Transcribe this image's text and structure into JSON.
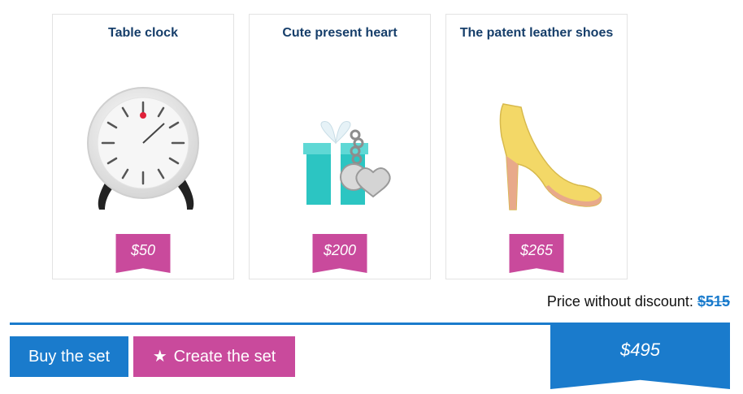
{
  "products": [
    {
      "title": "Table clock",
      "price": "$50",
      "image": "table-clock-image"
    },
    {
      "title": "Cute present heart",
      "price": "$200",
      "image": "gift-box-image"
    },
    {
      "title": "The patent leather shoes",
      "price": "$265",
      "image": "high-heel-shoe-image"
    }
  ],
  "summary": {
    "price_without_label": "Price without discount:",
    "price_without_value": "$515",
    "total": "$495"
  },
  "actions": {
    "buy_label": "Buy the set",
    "create_label": "Create the set",
    "create_icon": "star-icon"
  },
  "colors": {
    "accent_blue": "#1a7bcc",
    "accent_pink": "#c94a9c",
    "title_navy": "#163e6a"
  }
}
